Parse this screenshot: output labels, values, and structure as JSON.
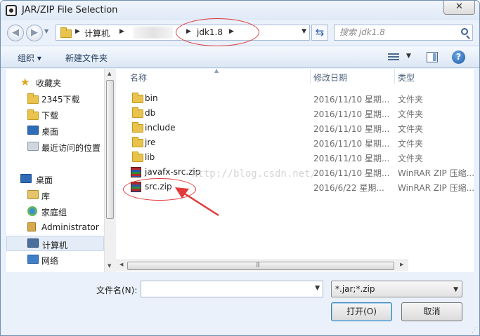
{
  "window": {
    "title": "JAR/ZIP File Selection",
    "close_glyph": "✕"
  },
  "address": {
    "segments": [
      "计算机",
      "jdk1.8"
    ],
    "search_placeholder": "搜索 jdk1.8"
  },
  "toolbar": {
    "organize_label": "组织 ▾",
    "new_folder_label": "新建文件夹"
  },
  "nav": {
    "favorites_label": "收藏夹",
    "favorites": [
      "2345下载",
      "下载",
      "桌面",
      "最近访问的位置"
    ],
    "desktop_label": "桌面",
    "desktop_items": [
      "库",
      "家庭组",
      "Administrator",
      "计算机",
      "网络"
    ]
  },
  "columns": {
    "name": "名称",
    "date": "修改日期",
    "type": "类型"
  },
  "files": [
    {
      "name": "bin",
      "date": "2016/11/10 星期...",
      "type": "文件夹",
      "icon": "folder-icon"
    },
    {
      "name": "db",
      "date": "2016/11/10 星期...",
      "type": "文件夹",
      "icon": "folder-icon"
    },
    {
      "name": "include",
      "date": "2016/11/10 星期...",
      "type": "文件夹",
      "icon": "folder-icon"
    },
    {
      "name": "jre",
      "date": "2016/11/10 星期...",
      "type": "文件夹",
      "icon": "folder-icon"
    },
    {
      "name": "lib",
      "date": "2016/11/10 星期...",
      "type": "文件夹",
      "icon": "folder-icon"
    },
    {
      "name": "javafx-src.zip",
      "date": "2016/11/10 星期...",
      "type": "WinRAR ZIP 压缩...",
      "icon": "winrar-icon"
    },
    {
      "name": "src.zip",
      "date": "2016/6/22 星期...",
      "type": "WinRAR ZIP 压缩...",
      "icon": "winrar-icon"
    }
  ],
  "watermark": "http://blog.csdn.net/",
  "bottom": {
    "filename_label": "文件名(N):",
    "filename_value": "",
    "filter_value": "*.jar;*.zip",
    "open_label": "打开(O)",
    "cancel_label": "取消"
  },
  "colors": {
    "annotation": "#e23a3a",
    "accent": "#2c5da8"
  }
}
